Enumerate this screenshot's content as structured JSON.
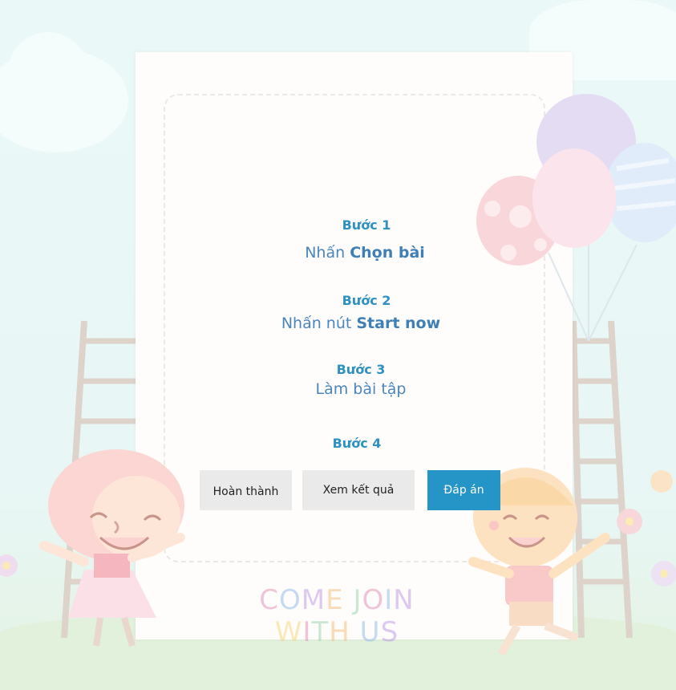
{
  "steps": [
    {
      "title": "Bước 1",
      "prefix": "Nhấn ",
      "bold": "Chọn bài"
    },
    {
      "title": "Bước 2",
      "prefix": "Nhấn nút ",
      "bold": "Start now"
    },
    {
      "title": "Bước 3",
      "prefix": "Làm bài tập",
      "bold": ""
    },
    {
      "title": "Bước 4"
    }
  ],
  "buttons": {
    "finish": "Hoàn thành",
    "view_result": "Xem kết quả",
    "answer": "Đáp án"
  },
  "banner": {
    "c1": "C",
    "c2": "O",
    "c3": "M",
    "c4": "E",
    "c5": "J",
    "c6": "O",
    "c7": "I",
    "c8": "N",
    "c9": "W",
    "c10": "I",
    "c11": "T",
    "c12": "H",
    "c13": "U",
    "c14": "S"
  },
  "colors": {
    "accent": "#2594c6",
    "step_title": "#2d91c2",
    "step_text": "#4a86bd",
    "button_gray": "#eaeaea"
  }
}
